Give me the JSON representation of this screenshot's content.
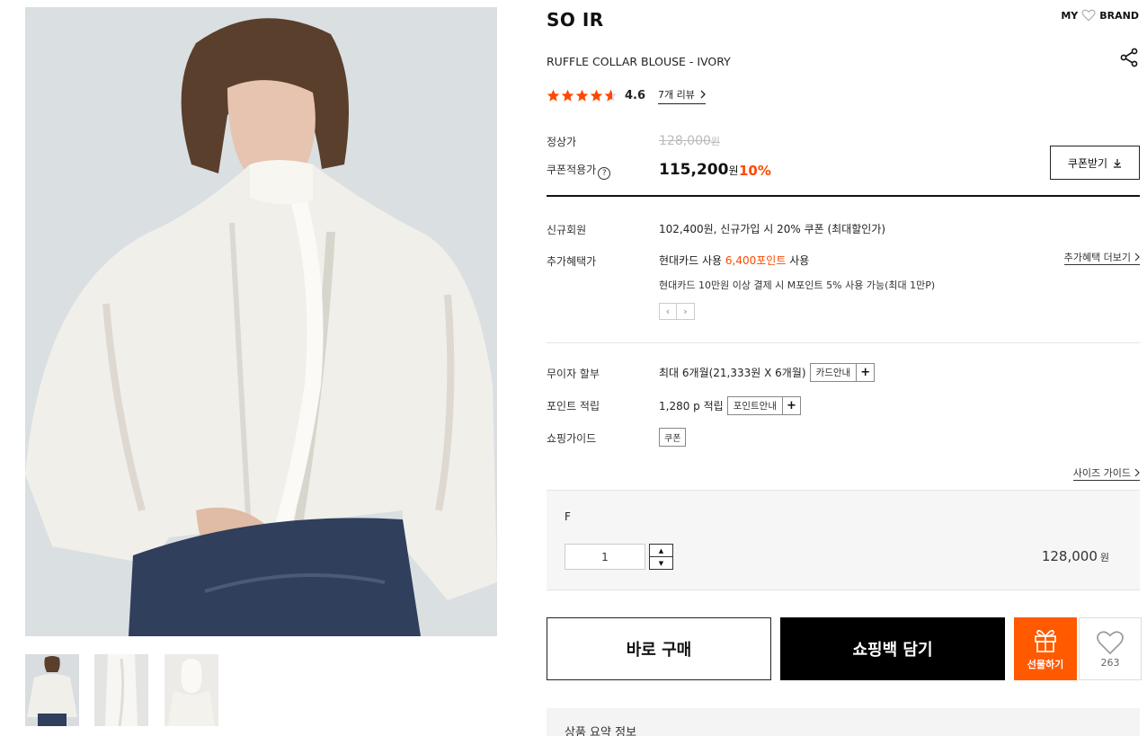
{
  "gallery": {
    "thumbnails": [
      "thumb-1",
      "thumb-2",
      "thumb-3"
    ]
  },
  "header": {
    "brand": "SO IR",
    "my_label": "MY",
    "brand_label": "BRAND",
    "product_name": "RUFFLE COLLAR BLOUSE - IVORY"
  },
  "rating": {
    "value": "4.6",
    "review_link": "7개 리뷰"
  },
  "price": {
    "regular_label": "정상가",
    "regular_value": "128,000",
    "regular_unit": "원",
    "coupon_label": "쿠폰적용가",
    "coupon_value": "115,200",
    "coupon_unit": "원",
    "discount": "10%",
    "coupon_button": "쿠폰받기"
  },
  "benefits": {
    "new_member_label": "신규회원",
    "new_member_value": "102,400원, 신규가입 시 20% 쿠폰 (최대할인가)",
    "extra_label": "추가혜택가",
    "extra_value_pre": "현대카드 사용",
    "extra_value_point": "6,400포인트",
    "extra_value_post": "사용",
    "extra_detail": "현대카드 10만원 이상 결제 시 M포인트 5% 사용 가능(최대 1만P)",
    "more_link": "추가혜택 더보기",
    "prev": "‹",
    "next": "›"
  },
  "payment": {
    "installment_label": "무이자 할부",
    "installment_value": "최대 6개월(21,333원 X 6개월)",
    "card_guide": "카드안내",
    "point_label": "포인트 적립",
    "point_value": "1,280 p 적립",
    "point_guide": "포인트안내",
    "shopping_label": "쇼핑가이드",
    "coupon_tag": "쿠폰",
    "size_guide": "사이즈 가이드",
    "plus": "+"
  },
  "option": {
    "size": "F",
    "quantity": "1",
    "price": "128,000",
    "unit": "원"
  },
  "actions": {
    "buy_now": "바로 구매",
    "add_cart": "쇼핑백 담기",
    "gift": "선물하기",
    "likes": "263"
  },
  "summary": {
    "title": "상품 요약 정보"
  },
  "colors": {
    "accent": "#ff4800",
    "gift_bg": "#ff5a00",
    "cart_bg": "#000000",
    "star": "#ff4800"
  }
}
